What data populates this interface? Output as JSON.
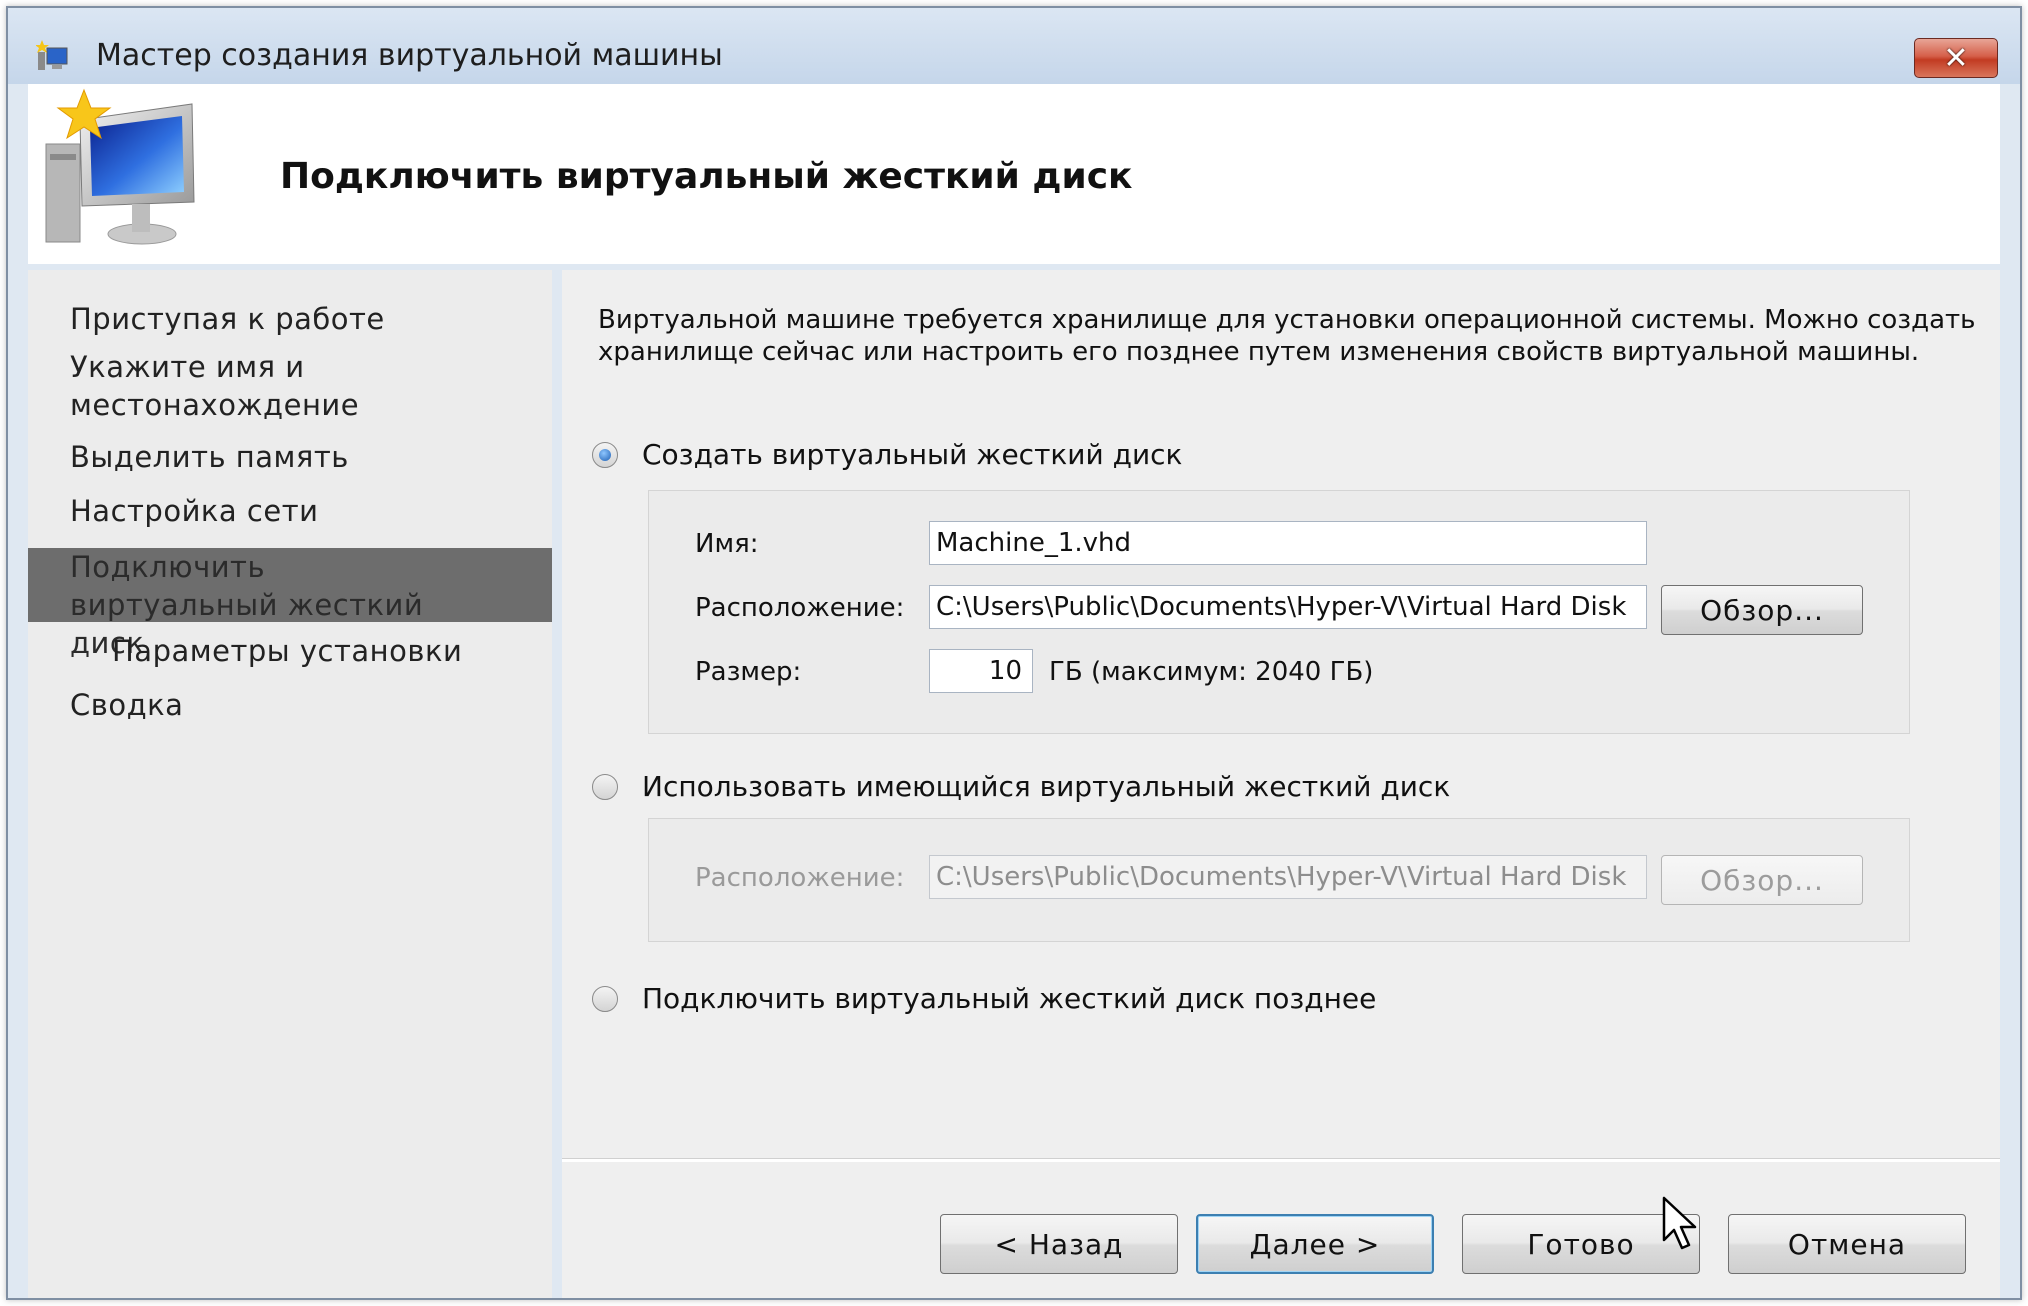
{
  "window": {
    "title": "Мастер создания виртуальной машины",
    "close_label": "✕"
  },
  "header": {
    "title": "Подключить виртуальный жесткий диск"
  },
  "nav": {
    "items": [
      {
        "label": "Приступая к работе"
      },
      {
        "label": "Укажите имя и местонахождение"
      },
      {
        "label": "Выделить память"
      },
      {
        "label": "Настройка сети"
      },
      {
        "label": "Подключить виртуальный жесткий диск",
        "active": true
      },
      {
        "label": "Параметры установки",
        "sub": true
      },
      {
        "label": "Сводка"
      }
    ]
  },
  "content": {
    "intro": "Виртуальной машине требуется хранилище для установки операционной системы. Можно создать хранилище сейчас или настроить его позднее путем изменения свойств виртуальной машины.",
    "option_create": {
      "label": "Создать виртуальный жесткий диск",
      "checked": true,
      "name_label": "Имя:",
      "name_value": "Machine_1.vhd",
      "location_label": "Расположение:",
      "location_value": "C:\\Users\\Public\\Documents\\Hyper-V\\Virtual Hard Disk",
      "browse_label": "Обзор...",
      "size_label": "Размер:",
      "size_value": "10",
      "size_hint": "ГБ (максимум: 2040 ГБ)"
    },
    "option_existing": {
      "label": "Использовать имеющийся виртуальный жесткий диск",
      "checked": false,
      "location_label": "Расположение:",
      "location_value": "C:\\Users\\Public\\Documents\\Hyper-V\\Virtual Hard Disk",
      "browse_label": "Обзор..."
    },
    "option_later": {
      "label": "Подключить виртуальный жесткий диск позднее",
      "checked": false
    }
  },
  "footer": {
    "back_label": "< Назад",
    "next_label": "Далее >",
    "finish_label": "Готово",
    "cancel_label": "Отмена"
  }
}
